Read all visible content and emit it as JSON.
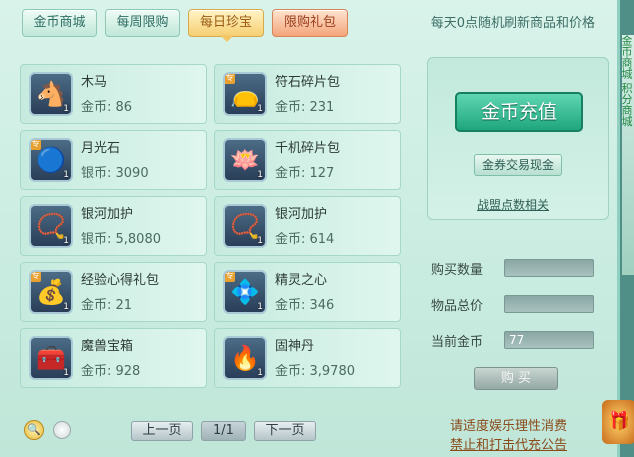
{
  "tabs": [
    {
      "label": "金币商城",
      "state": "normal"
    },
    {
      "label": "每周限购",
      "state": "normal"
    },
    {
      "label": "每日珍宝",
      "state": "active"
    },
    {
      "label": "限购礼包",
      "state": "limit"
    }
  ],
  "notice": "每天0点随机刷新商品和价格",
  "items": [
    {
      "name": "木马",
      "price": "金币: 86",
      "count": "1",
      "icon": "rocking-horse-icon",
      "glyph": "🐴",
      "tag": ""
    },
    {
      "name": "符石碎片包",
      "price": "金币: 231",
      "count": "1",
      "icon": "red-pouch-icon",
      "glyph": "👝",
      "tag": "专"
    },
    {
      "name": "月光石",
      "price": "银币: 3090",
      "count": "1",
      "icon": "moonstone-icon",
      "glyph": "🔵",
      "tag": "专"
    },
    {
      "name": "千机碎片包",
      "price": "金币: 127",
      "count": "1",
      "icon": "lotus-bowl-icon",
      "glyph": "🪷",
      "tag": ""
    },
    {
      "name": "银河加护",
      "price": "银币: 5,8080",
      "count": "1",
      "icon": "galaxy-chain-icon",
      "glyph": "📿",
      "tag": ""
    },
    {
      "name": "银河加护",
      "price": "金币: 614",
      "count": "1",
      "icon": "galaxy-chain-icon",
      "glyph": "📿",
      "tag": ""
    },
    {
      "name": "经验心得礼包",
      "price": "金币: 21",
      "count": "1",
      "icon": "exp-gift-bag-icon",
      "glyph": "💰",
      "tag": "专"
    },
    {
      "name": "精灵之心",
      "price": "金币: 346",
      "count": "1",
      "icon": "spirit-heart-icon",
      "glyph": "💠",
      "tag": "专"
    },
    {
      "name": "魔兽宝箱",
      "price": "金币: 928",
      "count": "1",
      "icon": "treasure-chest-icon",
      "glyph": "🧰",
      "tag": ""
    },
    {
      "name": "固神丹",
      "price": "金币: 3,9780",
      "count": "1",
      "icon": "fire-pill-icon",
      "glyph": "🔥",
      "tag": ""
    }
  ],
  "side": {
    "recharge_label": "金币充值",
    "exchange_label": "金券交易现金",
    "alliance_link": "战盟点数相关"
  },
  "fields": {
    "qty_label": "购买数量",
    "qty_value": "",
    "total_label": "物品总价",
    "total_value": "",
    "current_label": "当前金币",
    "current_value": "77"
  },
  "buy_label": "购 买",
  "pager": {
    "prev": "上一页",
    "page": "1/1",
    "next": "下一页"
  },
  "footer": {
    "line1": "请适度娱乐理性消费",
    "line2": "禁止和打击代充公告"
  },
  "edge_text": "金币商城 积分商城",
  "colors": {
    "active_tab": "#f6cf72",
    "limit_tab": "#f3a57a",
    "recharge": "#1fa67c"
  }
}
